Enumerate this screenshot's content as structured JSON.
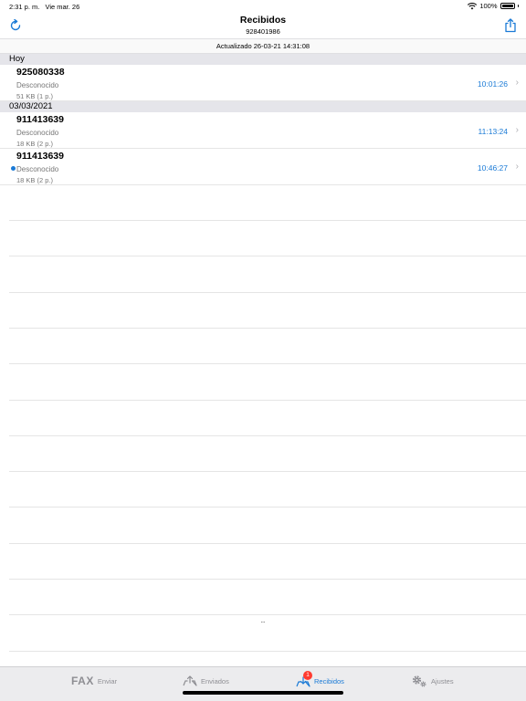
{
  "status_bar": {
    "time": "2:31 p. m.",
    "date": "Vie mar. 26",
    "battery": "100%",
    "icons": [
      "wifi-icon",
      "battery-icon"
    ]
  },
  "nav": {
    "title": "Recibidos",
    "subtitle": "928401986",
    "left_icon": "refresh-icon",
    "right_icon": "share-icon"
  },
  "updated_text": "Actualizado 26-03-21 14:31:08",
  "sections": [
    {
      "header": "Hoy",
      "rows": [
        {
          "number": "925080338",
          "sender": "Desconocido",
          "size": "51 KB (1 p.)",
          "time": "10:01:26",
          "unread": false
        }
      ]
    },
    {
      "header": "03/03/2021",
      "rows": [
        {
          "number": "911413639",
          "sender": "Desconocido",
          "size": "18 KB (2 p.)",
          "time": "11:13:24",
          "unread": false
        },
        {
          "number": "911413639",
          "sender": "Desconocido",
          "size": "18 KB (2 p.)",
          "time": "10:46:27",
          "unread": true
        }
      ]
    }
  ],
  "scroll_mark": "..",
  "tabs": [
    {
      "logo": "FAX",
      "label": "Enviar",
      "icon": "fax-icon",
      "active": false
    },
    {
      "label": "Enviados",
      "icon": "sent-tray-icon",
      "active": false
    },
    {
      "label": "Recibidos",
      "icon": "inbox-tray-icon",
      "active": true,
      "badge": "1"
    },
    {
      "label": "Ajustes",
      "icon": "gear-icon",
      "active": false
    }
  ],
  "colors": {
    "accent": "#1a7ad6",
    "badge": "#ff3b30",
    "section_bg": "#e5e5ea",
    "tab_bar_bg": "#ececee"
  }
}
